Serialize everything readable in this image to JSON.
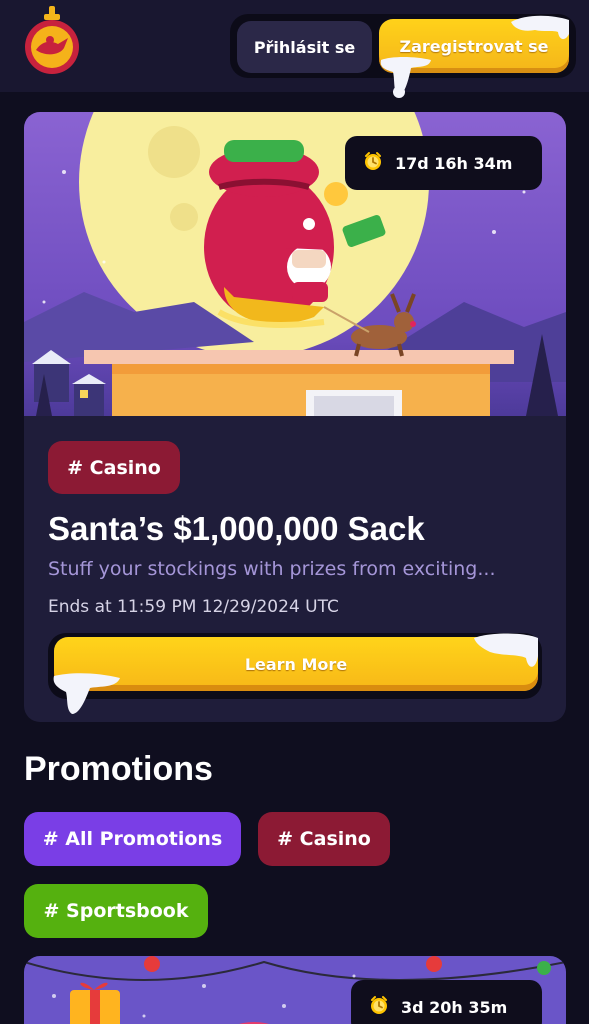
{
  "header": {
    "logo_icon": "genie-lamp-ornament-icon",
    "login_label": "Přihlásit se",
    "register_label": "Zaregistrovat se"
  },
  "featured": {
    "timer_icon": "clock-icon",
    "timer": "17d 16h 34m",
    "tag": "# Casino",
    "title": "Santa’s $1,000,000 Sack",
    "subtitle": "Stuff your stockings with prizes from exciting...",
    "ends": "Ends at 11:59 PM 12/29/2024 UTC",
    "button_label": "Learn More"
  },
  "promotions": {
    "title": "Promotions",
    "filters": [
      {
        "label": "# All Promotions",
        "color": "#7a3ee6"
      },
      {
        "label": "# Casino",
        "color": "#8c1a34"
      },
      {
        "label": "# Sportsbook",
        "color": "#55b10f"
      }
    ]
  },
  "second_card": {
    "timer_icon": "clock-icon",
    "timer": "3d 20h 35m"
  },
  "colors": {
    "background": "#0f0e1f",
    "header": "#191730",
    "card": "#1f1d3a",
    "accent_yellow": "#ffd21a",
    "casino_red": "#8c1a34"
  }
}
